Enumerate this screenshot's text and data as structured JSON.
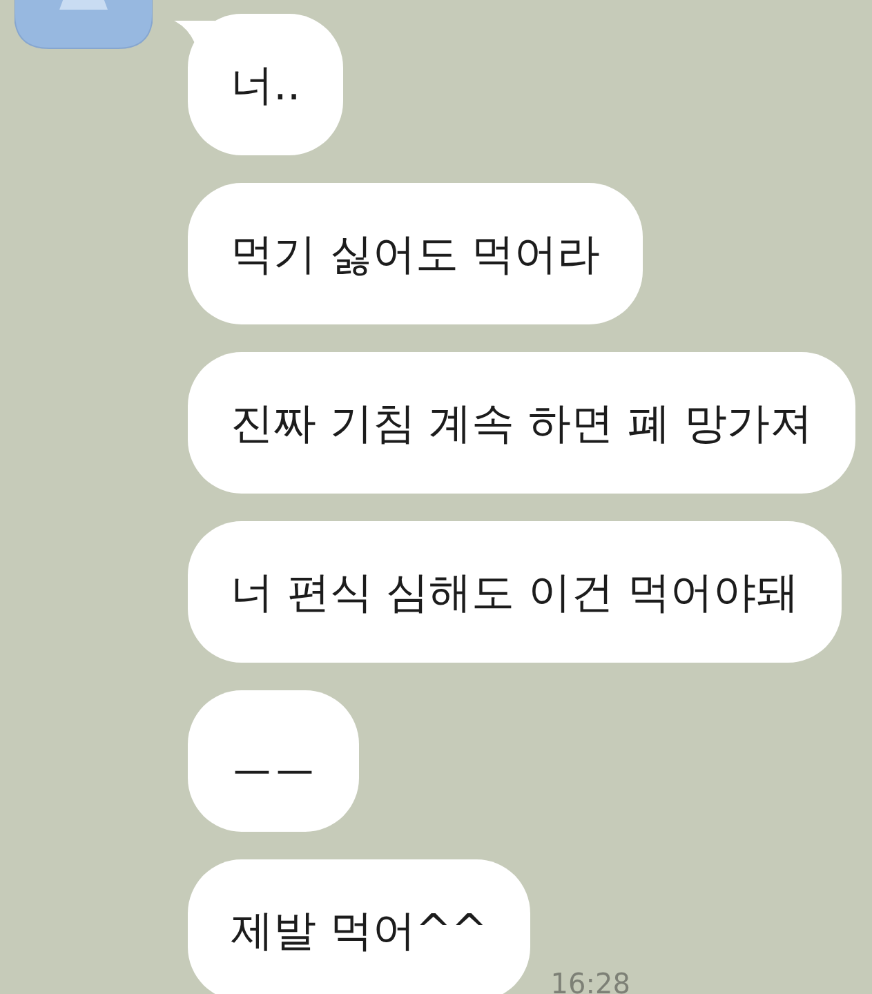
{
  "messages": [
    {
      "text": "너..",
      "tail": true
    },
    {
      "text": "먹기 싫어도 먹어라",
      "tail": false
    },
    {
      "text": "진짜 기침 계속 하면 폐 망가져",
      "tail": false
    },
    {
      "text": "너 편식 심해도 이건 먹어야돼",
      "tail": false
    },
    {
      "text": "ㅡㅡ",
      "tail": false
    },
    {
      "text": "제발 먹어^^",
      "tail": false
    }
  ],
  "time": "16:28"
}
